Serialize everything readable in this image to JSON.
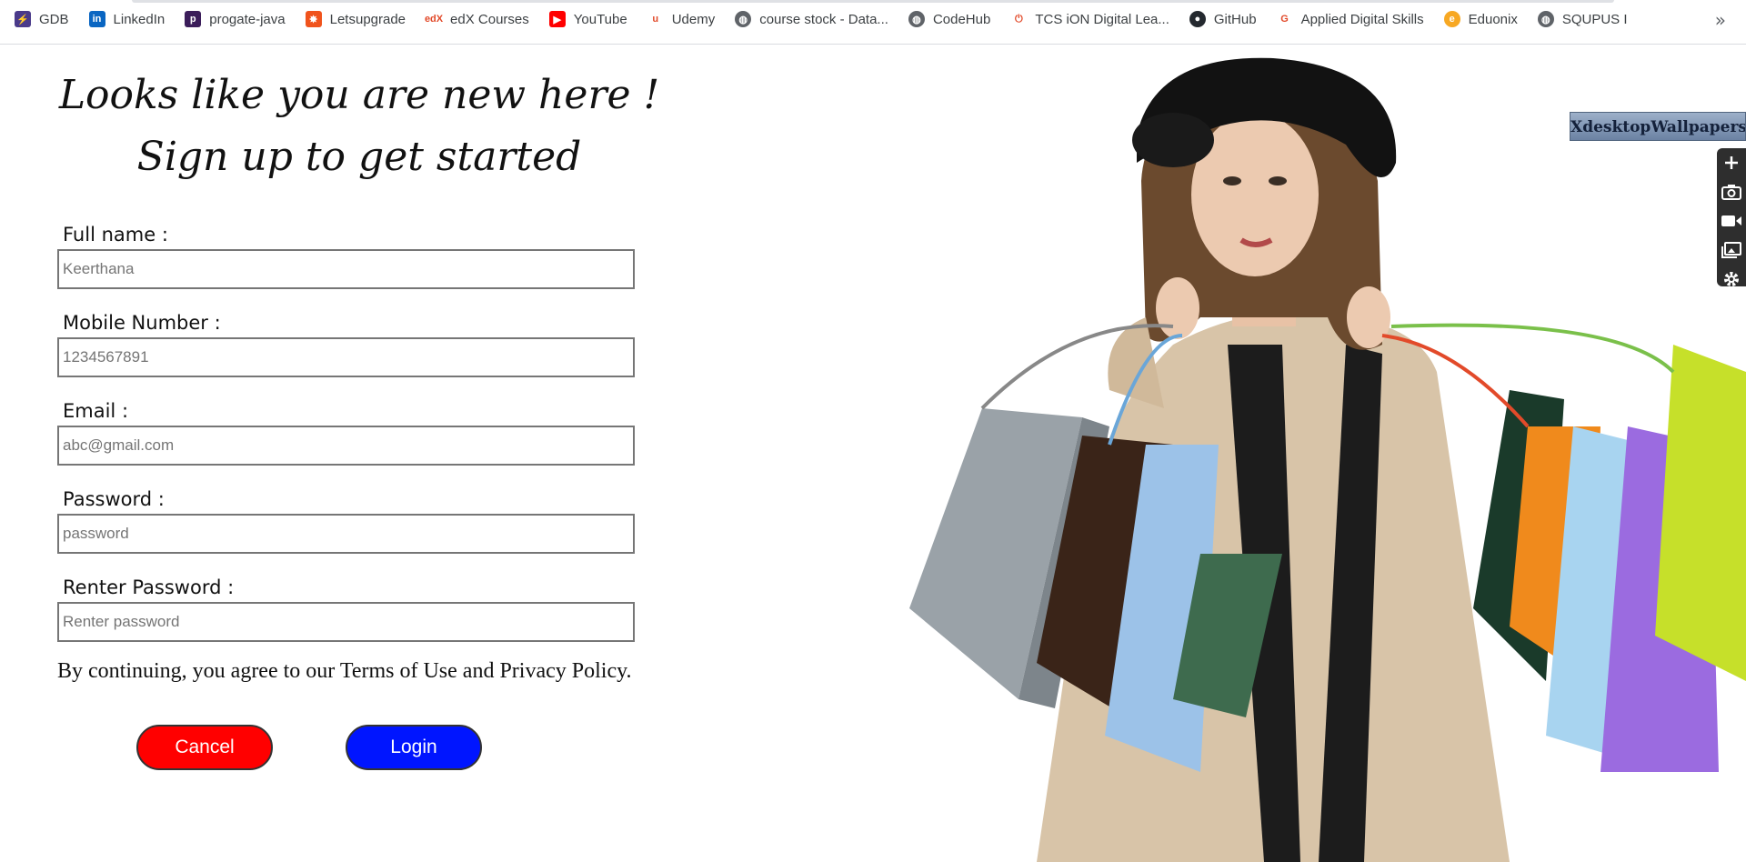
{
  "bookmarks": [
    {
      "label": "GDB",
      "icon": "gdb-icon",
      "color": "#4a3a8a",
      "glyph": "⚡"
    },
    {
      "label": "LinkedIn",
      "icon": "linkedin-icon",
      "color": "#0a66c2",
      "glyph": "in"
    },
    {
      "label": "progate-java",
      "icon": "progate-icon",
      "color": "#3b1d5a",
      "glyph": "p"
    },
    {
      "label": "Letsupgrade",
      "icon": "letsupgrade-icon",
      "color": "#f0531c",
      "glyph": "✸"
    },
    {
      "label": "edX Courses",
      "icon": "edx-icon",
      "color": "#ffffff",
      "glyph": "edX"
    },
    {
      "label": "YouTube",
      "icon": "youtube-icon",
      "color": "#ff0000",
      "glyph": "▶"
    },
    {
      "label": "Udemy",
      "icon": "udemy-icon",
      "color": "#ffffff",
      "glyph": "u"
    },
    {
      "label": "course stock - Data...",
      "icon": "globe-icon",
      "color": "#5f6368",
      "glyph": "◍"
    },
    {
      "label": "CodeHub",
      "icon": "globe-icon",
      "color": "#5f6368",
      "glyph": "◍"
    },
    {
      "label": "TCS iON Digital Lea...",
      "icon": "tcs-ion-icon",
      "color": "#ffffff",
      "glyph": "⏻"
    },
    {
      "label": "GitHub",
      "icon": "github-icon",
      "color": "#24292f",
      "glyph": "●"
    },
    {
      "label": "Applied Digital Skills",
      "icon": "google-icon",
      "color": "#ffffff",
      "glyph": "G"
    },
    {
      "label": "Eduonix",
      "icon": "eduonix-icon",
      "color": "#f7a823",
      "glyph": "e"
    },
    {
      "label": "SQUPUS I",
      "icon": "globe-icon",
      "color": "#5f6368",
      "glyph": "◍"
    }
  ],
  "more_glyph": "»",
  "heading": {
    "line1": "Looks like you are new here !",
    "line2": "Sign up to get started"
  },
  "fields": [
    {
      "label": "Full name :",
      "placeholder": "Keerthana",
      "type": "text"
    },
    {
      "label": "Mobile Number :",
      "placeholder": "1234567891",
      "type": "text"
    },
    {
      "label": "Email :",
      "placeholder": "abc@gmail.com",
      "type": "email"
    },
    {
      "label": "Password :",
      "placeholder": "password",
      "type": "password"
    },
    {
      "label": "Renter Password :",
      "placeholder": "Renter password",
      "type": "password"
    }
  ],
  "terms": "By continuing, you agree to our Terms of Use and Privacy Policy.",
  "buttons": {
    "cancel": "Cancel",
    "login": "Login"
  },
  "colors": {
    "cancel_bg": "#ff0000",
    "login_bg": "#0015ff"
  },
  "watermark": "XdesktopWallpapers.Com",
  "tools": [
    "plus-icon",
    "camera-icon",
    "video-icon",
    "gallery-icon",
    "settings-icon"
  ]
}
